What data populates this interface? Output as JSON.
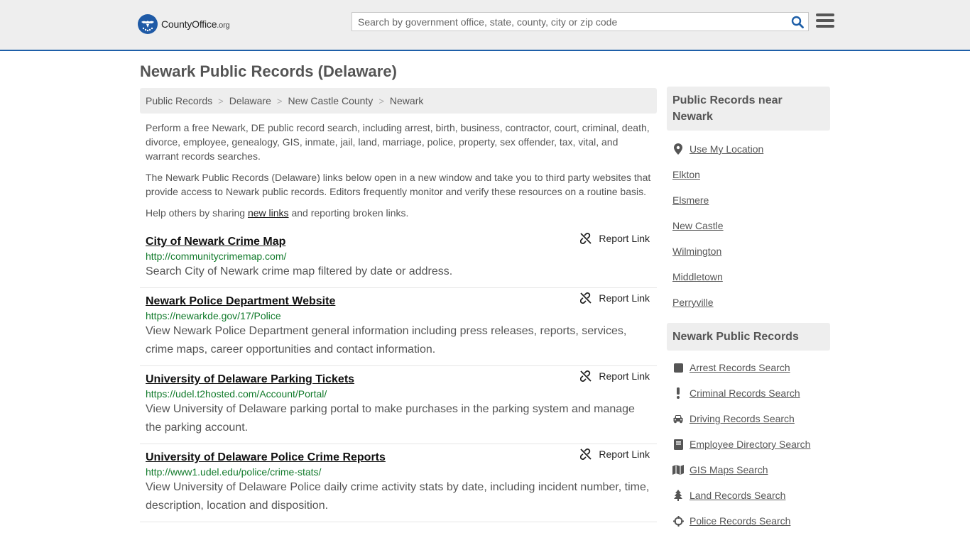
{
  "brand": {
    "name_county": "County",
    "name_office": "Office",
    "name_tld": ".org"
  },
  "search": {
    "placeholder": "Search by government office, state, county, city or zip code"
  },
  "page": {
    "title": "Newark Public Records (Delaware)"
  },
  "breadcrumb": [
    "Public Records",
    "Delaware",
    "New Castle County",
    "Newark"
  ],
  "intro": {
    "p1": "Perform a free Newark, DE public record search, including arrest, birth, business, contractor, court, criminal, death, divorce, employee, genealogy, GIS, inmate, jail, land, marriage, police, property, sex offender, tax, vital, and warrant records searches.",
    "p2": "The Newark Public Records (Delaware) links below open in a new window and take you to third party websites that provide access to Newark public records. Editors frequently monitor and verify these resources on a routine basis.",
    "p3_before": "Help others by sharing ",
    "p3_link": "new links",
    "p3_after": " and reporting broken links."
  },
  "report_label": "Report Link",
  "links": [
    {
      "title": "City of Newark Crime Map",
      "url": "http://communitycrimemap.com/",
      "desc": "Search City of Newark crime map filtered by date or address."
    },
    {
      "title": "Newark Police Department Website",
      "url": "https://newarkde.gov/17/Police",
      "desc": "View Newark Police Department general information including press releases, reports, services, crime maps, career opportunities and contact information."
    },
    {
      "title": "University of Delaware Parking Tickets",
      "url": "https://udel.t2hosted.com/Account/Portal/",
      "desc": "View University of Delaware parking portal to make purchases in the parking system and manage the parking account."
    },
    {
      "title": "University of Delaware Police Crime Reports",
      "url": "http://www1.udel.edu/police/crime-stats/",
      "desc": "View University of Delaware Police daily crime activity stats by date, including incident number, time, description, location and disposition."
    }
  ],
  "sidebar": {
    "nearby_title": "Public Records near Newark",
    "use_location": "Use My Location",
    "nearby": [
      "Elkton",
      "Elsmere",
      "New Castle",
      "Wilmington",
      "Middletown",
      "Perryville"
    ],
    "records_title": "Newark Public Records",
    "records": [
      {
        "label": "Arrest Records Search",
        "icon": "square-icon"
      },
      {
        "label": "Criminal Records Search",
        "icon": "exclamation-icon"
      },
      {
        "label": "Driving Records Search",
        "icon": "car-icon"
      },
      {
        "label": "Employee Directory Search",
        "icon": "book-icon"
      },
      {
        "label": "GIS Maps Search",
        "icon": "map-icon"
      },
      {
        "label": "Land Records Search",
        "icon": "tree-icon"
      },
      {
        "label": "Police Records Search",
        "icon": "crosshair-icon"
      }
    ]
  },
  "colors": {
    "accent": "#1e5fa8",
    "url_green": "#117a2b",
    "panel": "#eeeeee"
  }
}
